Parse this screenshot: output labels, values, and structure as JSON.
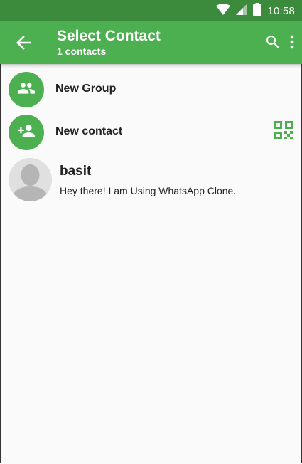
{
  "status_bar": {
    "time": "10:58",
    "icons": [
      "wifi-icon",
      "signal-icon",
      "battery-icon"
    ]
  },
  "app_bar": {
    "title": "Select Contact",
    "subtitle": "1 contacts",
    "back_icon": "arrow-back-icon",
    "actions": [
      "search-icon",
      "more-vert-icon"
    ]
  },
  "actions_list": [
    {
      "label": "New Group",
      "icon": "group-icon"
    },
    {
      "label": "New contact",
      "icon": "person-add-icon",
      "trailing_icon": "qr-code-icon"
    }
  ],
  "contacts": [
    {
      "name": "basit",
      "status": "Hey there! I am Using WhatsApp Clone."
    }
  ],
  "colors": {
    "primary": "#4caf50",
    "status_bar": "#3c8b3d",
    "background": "#fafafa"
  }
}
